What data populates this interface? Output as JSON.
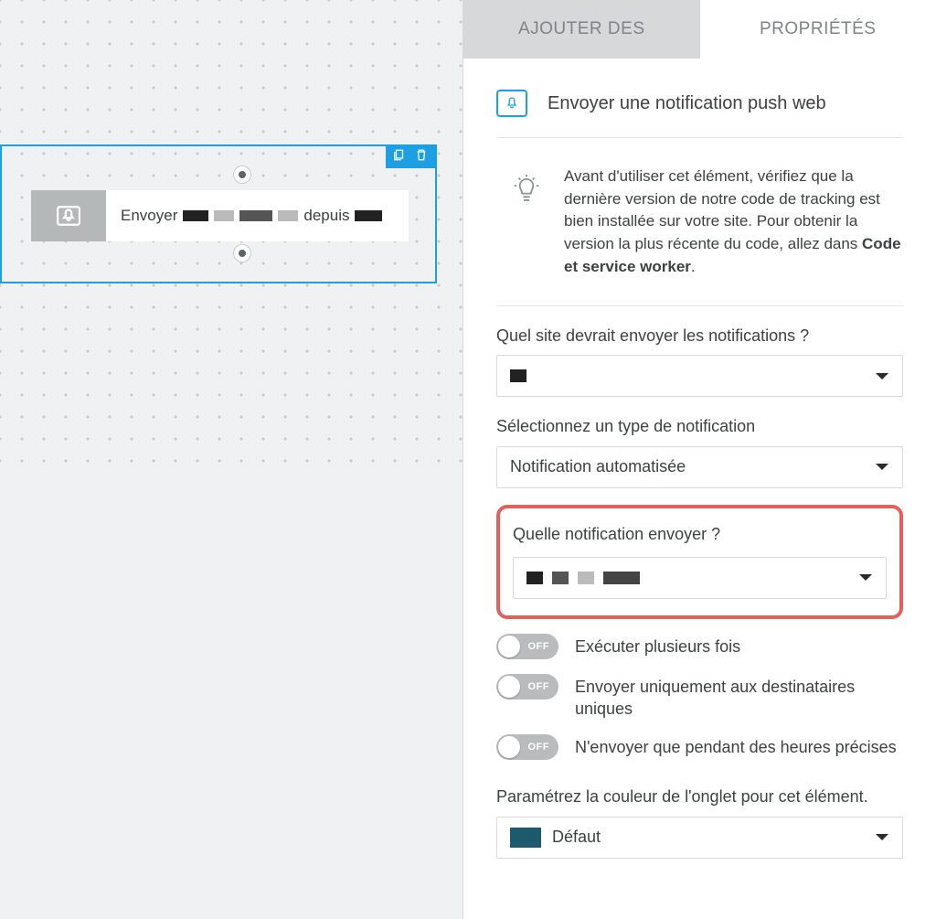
{
  "tabs": {
    "add": "AJOUTER DES",
    "properties": "PROPRIÉTÉS"
  },
  "canvas_node": {
    "prefix": "Envoyer",
    "middle": "depuis"
  },
  "header": {
    "title": "Envoyer une notification push web"
  },
  "info": {
    "text_before_bold": "Avant d'utiliser cet élément, vérifiez que la dernière version de notre code de tracking est bien installée sur votre site. Pour obtenir la version la plus récente du code, allez dans ",
    "bold": "Code et service worker",
    "text_after_bold": "."
  },
  "fields": {
    "site_label": "Quel site devrait envoyer les notifications ?",
    "type_label": "Sélectionnez un type de notification",
    "type_value": "Notification automatisée",
    "which_label": "Quelle notification envoyer ?",
    "color_label": "Paramétrez la couleur de l'onglet pour cet élément.",
    "color_value": "Défaut"
  },
  "toggles": {
    "off_label": "OFF",
    "multiple": "Exécuter plusieurs fois",
    "unique": "Envoyer uniquement aux destinataires uniques",
    "hours": "N'envoyer que pendant des heures précises"
  }
}
